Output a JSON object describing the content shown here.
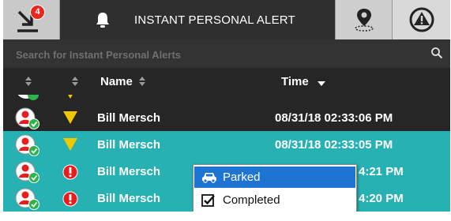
{
  "tabs": {
    "inbox_badge": "4",
    "alert_title": "INSTANT PERSONAL ALERT"
  },
  "search": {
    "placeholder": "Search for Instant Personal Alerts",
    "value": ""
  },
  "table": {
    "headers": {
      "name": "Name",
      "time": "Time"
    },
    "rows": [
      {
        "name": "Bill Mersch",
        "time": "08/31/18 02:33:06 PM",
        "priority": "medium",
        "selected": false
      },
      {
        "name": "Bill Mersch",
        "time": "08/31/18 02:33:05 PM",
        "priority": "medium",
        "selected": true
      },
      {
        "name": "Bill Mersch",
        "time": "4:21 PM",
        "priority": "high",
        "selected": true
      },
      {
        "name": "Bill Mersch",
        "time": "4:20 PM",
        "priority": "high",
        "selected": true
      }
    ]
  },
  "context_menu": {
    "items": [
      {
        "label": "Parked",
        "icon": "car-icon",
        "highlighted": true
      },
      {
        "label": "Completed",
        "icon": "checkbox-icon",
        "highlighted": false
      }
    ]
  },
  "colors": {
    "selected_row": "#27b1b3",
    "priority_medium": "#f0c800",
    "priority_high": "#e81e1e",
    "menu_highlight": "#1d74d2"
  }
}
